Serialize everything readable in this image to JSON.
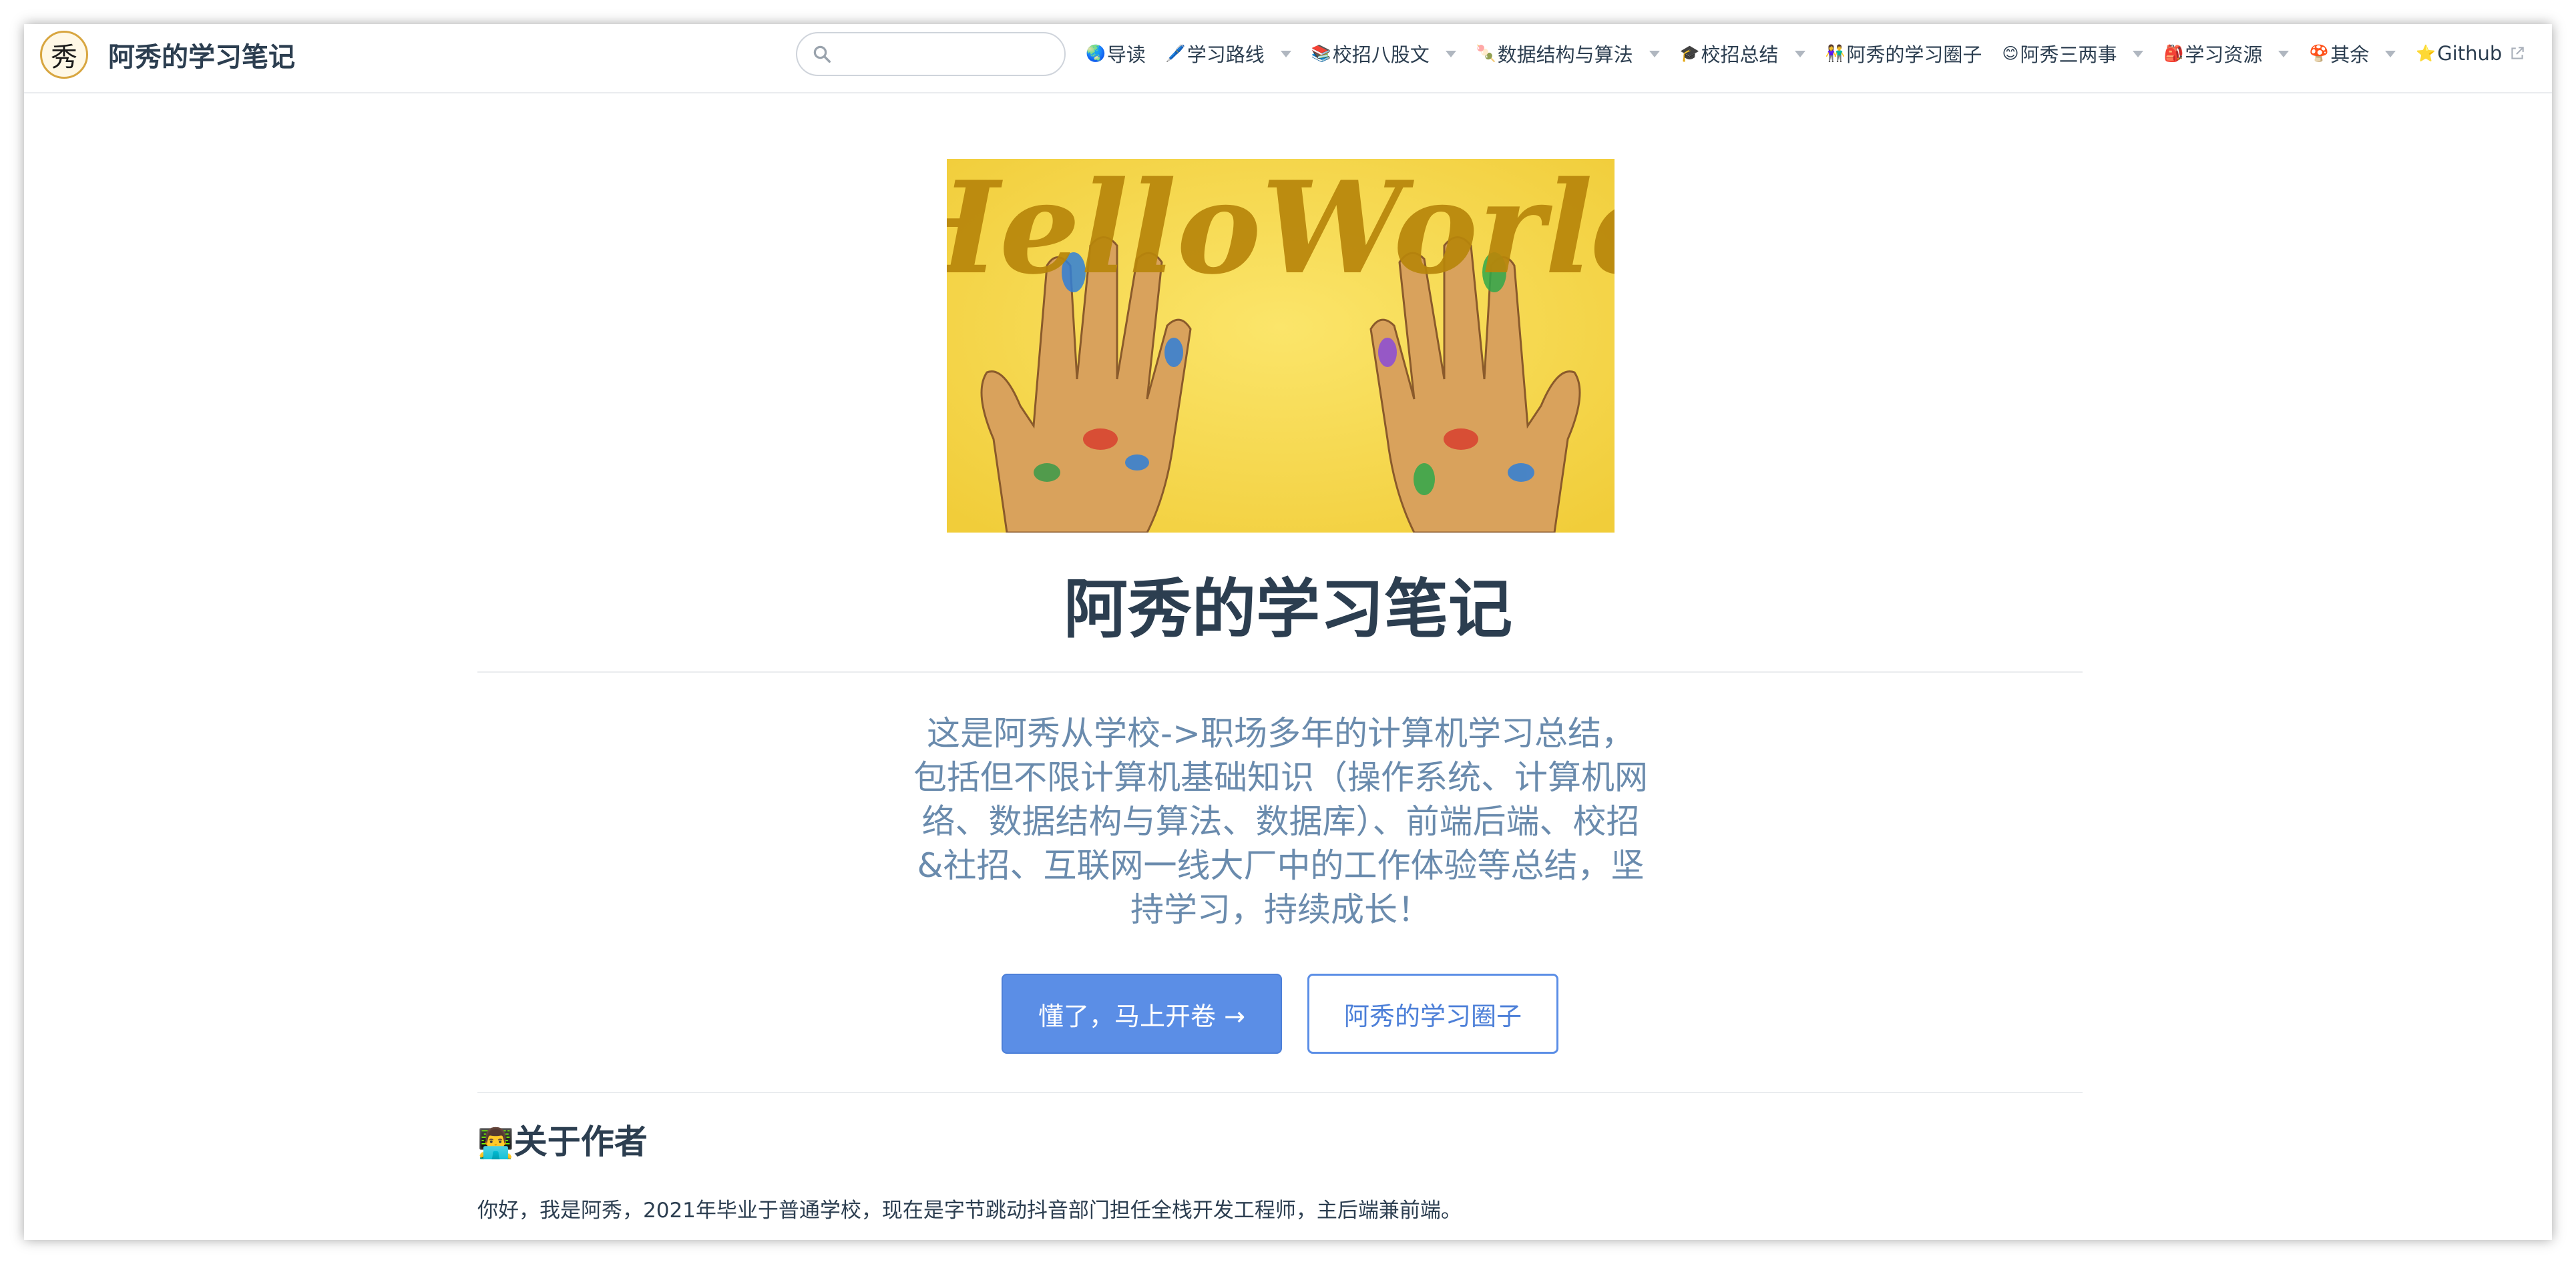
{
  "header": {
    "logo_char": "秀",
    "site_title": "阿秀的学习笔记",
    "search": {
      "value": "",
      "placeholder": ""
    },
    "nav": [
      {
        "emoji": "🌏",
        "label": "导读",
        "dropdown": false
      },
      {
        "emoji": "🖊️",
        "label": "学习路线",
        "dropdown": true
      },
      {
        "emoji": "📚",
        "label": "校招八股文",
        "dropdown": true
      },
      {
        "emoji": "🍡",
        "label": "数据结构与算法",
        "dropdown": true
      },
      {
        "emoji": "🎓",
        "label": "校招总结",
        "dropdown": true
      },
      {
        "emoji": "👫",
        "label": "阿秀的学习圈子",
        "dropdown": false
      },
      {
        "emoji": "😊",
        "label": "阿秀三两事",
        "dropdown": true
      },
      {
        "emoji": "🎒",
        "label": "学习资源",
        "dropdown": true
      },
      {
        "emoji": "🍄",
        "label": "其余",
        "dropdown": true
      },
      {
        "emoji": "⭐",
        "label": "Github",
        "dropdown": false,
        "external": true
      }
    ]
  },
  "hero": {
    "image_text": "HelloWorld",
    "title": "阿秀的学习笔记",
    "description": "这是阿秀从学校->职场多年的计算机学习总结，包括但不限计算机基础知识（操作系统、计算机网络、数据结构与算法、数据库）、前端后端、校招&社招、互联网一线大厂中的工作体验等总结，坚持学习，持续成长！",
    "primary_action": "懂了，马上开卷 →",
    "secondary_action": "阿秀的学习圈子"
  },
  "about": {
    "heading_emoji": "👨‍💻",
    "heading": "关于作者",
    "text": "你好，我是阿秀，2021年毕业于普通学校，现在是字节跳动抖音部门担任全栈开发工程师，主后端兼前端。"
  },
  "colors": {
    "accent": "#5b8ee6",
    "text": "#2c3e50",
    "description": "#6a8bad",
    "hero_bg": "#f7d84a",
    "hero_lettering": "#b8860b"
  }
}
